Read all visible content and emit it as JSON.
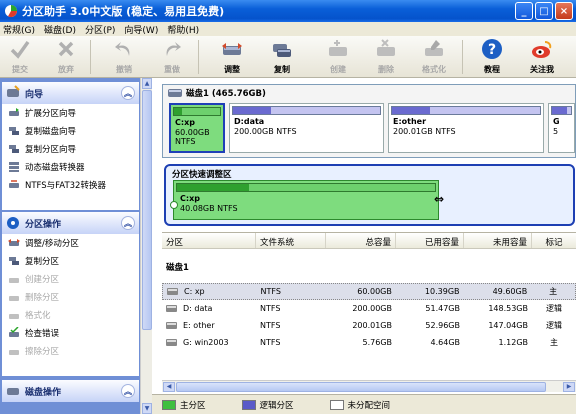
{
  "window": {
    "title": "分区助手 3.0中文版 (稳定、易用且免费)",
    "minimize": "_",
    "maximize": "□",
    "close": "×"
  },
  "menu": [
    "常规(G)",
    "磁盘(D)",
    "分区(P)",
    "向导(W)",
    "帮助(H)"
  ],
  "toolbar": {
    "submit": "提交",
    "discard": "放弃",
    "undo": "撤销",
    "redo": "重做",
    "adjust": "调整",
    "copy": "复制",
    "create": "创建",
    "delete": "删除",
    "format": "格式化",
    "tutorial": "教程",
    "follow": "关注我"
  },
  "sidebar": {
    "wizard_title": "向导",
    "wizard_items": [
      "扩展分区向导",
      "复制磁盘向导",
      "复制分区向导",
      "动态磁盘转换器",
      "NTFS与FAT32转换器"
    ],
    "partition_ops_title": "分区操作",
    "partition_ops_items": [
      "调整/移动分区",
      "复制分区",
      "创建分区",
      "删除分区",
      "格式化",
      "检查错误",
      "擦除分区"
    ],
    "disk_ops_title": "磁盘操作",
    "collapse_glyph": "︽"
  },
  "disk_map": {
    "disk_label": "磁盘1 (465.76GB)",
    "partitions": [
      {
        "name": "C:xp",
        "size": "60.00GB NTFS",
        "used_fraction": 0.17,
        "selected": true
      },
      {
        "name": "D:data",
        "size": "200.00GB NTFS",
        "used_fraction": 0.26,
        "selected": false
      },
      {
        "name": "E:other",
        "size": "200.01GB NTFS",
        "used_fraction": 0.26,
        "selected": false
      },
      {
        "name": "G",
        "size": "5",
        "used_fraction": 0.8,
        "selected": false
      }
    ]
  },
  "quick_resize": {
    "title": "分区快速调整区",
    "name": "C:xp",
    "size": "40.08GB NTFS",
    "resize_glyph": "⇔"
  },
  "table": {
    "headers": [
      "分区",
      "文件系统",
      "总容量",
      "已用容量",
      "未用容量",
      "标记"
    ],
    "group": "磁盘1",
    "rows": [
      {
        "part": "C:  xp",
        "fs": "NTFS",
        "total": "60.00GB",
        "used": "10.39GB",
        "free": "49.60GB",
        "flag": "主",
        "selected": true
      },
      {
        "part": "D:  data",
        "fs": "NTFS",
        "total": "200.00GB",
        "used": "51.47GB",
        "free": "148.53GB",
        "flag": "逻辑",
        "selected": false
      },
      {
        "part": "E:  other",
        "fs": "NTFS",
        "total": "200.01GB",
        "used": "52.96GB",
        "free": "147.04GB",
        "flag": "逻辑",
        "selected": false
      },
      {
        "part": "G:  win2003",
        "fs": "NTFS",
        "total": "5.76GB",
        "used": "4.64GB",
        "free": "1.12GB",
        "flag": "主",
        "selected": false
      }
    ]
  },
  "legend": {
    "primary": "主分区",
    "logical": "逻辑分区",
    "unallocated": "未分配空间",
    "primary_color": "#3fbf3f",
    "logical_color": "#5a5ac8",
    "unallocated_color": "#ffffff"
  }
}
